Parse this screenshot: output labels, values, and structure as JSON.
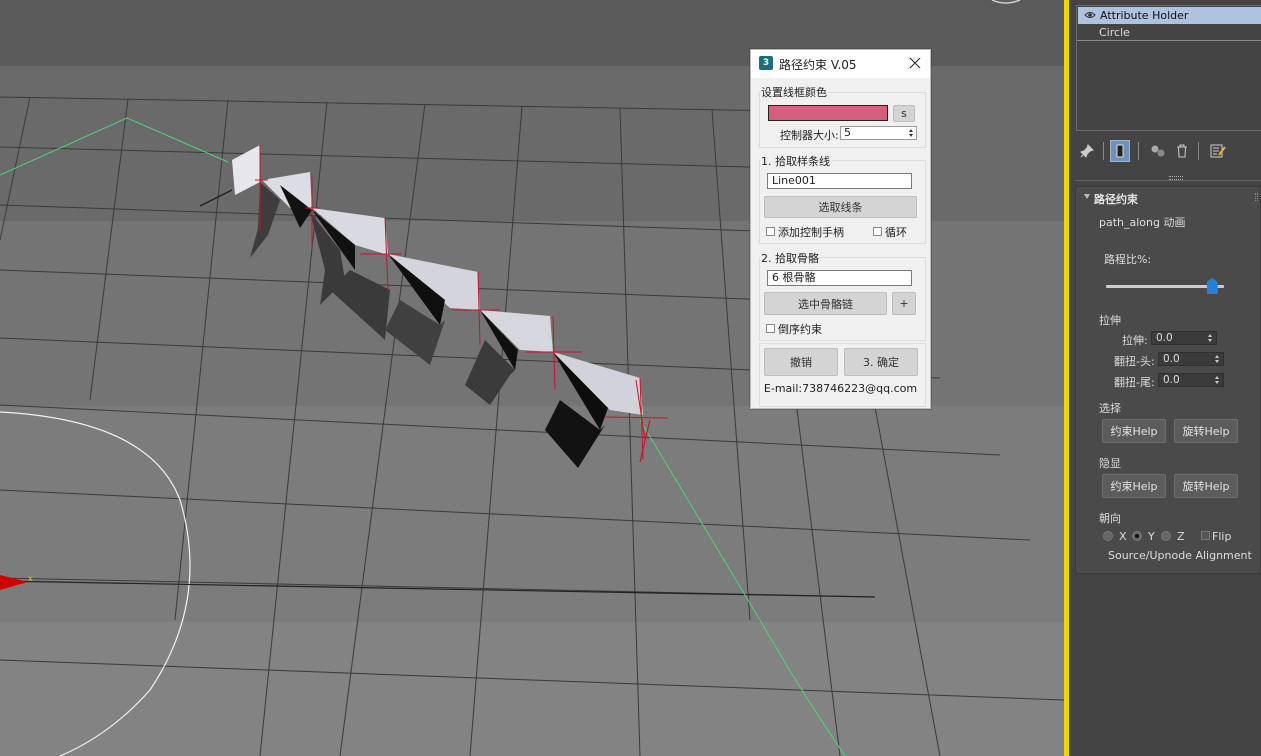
{
  "viewport": {
    "axis_label": "x"
  },
  "dialog": {
    "logo": "3",
    "title": "路径约束 V.05",
    "wire_color_group": "设置线框颜色",
    "wire_color": "#d4607e",
    "s_button": "s",
    "controller_size_label": "控制器大小:",
    "controller_size_value": "5",
    "pick_spline_group": "1. 拾取样条线",
    "spline_value": "Line001",
    "select_spline_button": "选取线条",
    "add_handles_label": "添加控制手柄",
    "loop_label": "循环",
    "pick_bones_group": "2. 拾取骨骼",
    "bones_value": "6 根骨骼",
    "select_bone_chain_button": "选中骨骼链",
    "plus_button": "+",
    "reverse_label": "倒序约束",
    "undo_button": "撤销",
    "confirm_button": "3. 确定",
    "email": "E-mail:738746223@qq.com"
  },
  "panel": {
    "stack": [
      {
        "label": "Attribute Holder",
        "selected": true
      },
      {
        "label": "Circle",
        "selected": false
      }
    ],
    "rollout_title": "路径约束",
    "subtitle": "path_along 动画",
    "path_percent_label": "路程比%:",
    "path_percent_value": 0.9,
    "stretch_group": "拉伸",
    "stretch_label": "拉伸:",
    "stretch_value": "0.0",
    "twist_head_label": "翻扭-头:",
    "twist_head_value": "0.0",
    "twist_tail_label": "翻扭-尾:",
    "twist_tail_value": "0.0",
    "select_group": "选择",
    "select_constraint_help": "约束Help",
    "select_rotate_help": "旋转Help",
    "hide_group": "隐显",
    "hide_constraint_help": "约束Help",
    "hide_rotate_help": "旋转Help",
    "orient_group": "朝向",
    "orient_x": "X",
    "orient_y": "Y",
    "orient_z": "Z",
    "orient_selected": "Y",
    "flip_label": "Flip",
    "alignment_label": "Source/Upnode Alignment"
  }
}
